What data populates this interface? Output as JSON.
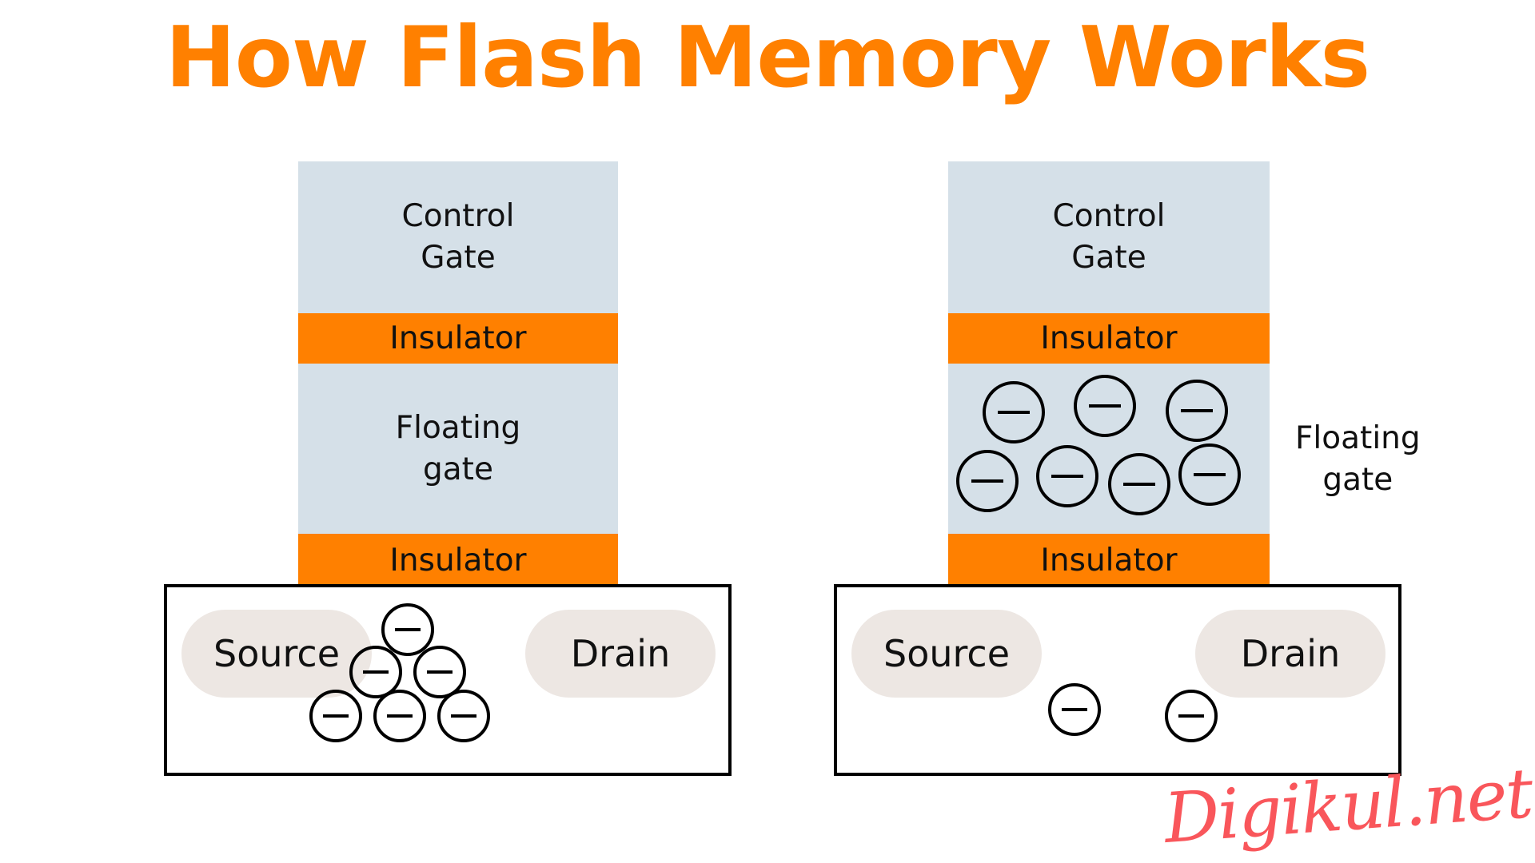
{
  "title": "How Flash Memory Works",
  "colors": {
    "title_orange": "#FF8000",
    "insulator_orange": "#FF8000",
    "gate_blue_gray": "#D5E0E8",
    "terminal_beige": "#EDE7E3",
    "outline_black": "#000000",
    "watermark_coral": "#F9565B",
    "background": "#FFFFFF"
  },
  "diagram": {
    "type": "flash-memory-cell-comparison",
    "cells": [
      {
        "id": "erased-cell",
        "position": "left",
        "layers": [
          {
            "name": "control-gate",
            "lines": [
              "Control",
              "Gate"
            ]
          },
          {
            "name": "insulator-top",
            "lines": [
              "Insulator"
            ]
          },
          {
            "name": "floating-gate",
            "lines": [
              "Floating",
              "gate"
            ]
          },
          {
            "name": "insulator-bottom",
            "lines": [
              "Insulator"
            ]
          }
        ],
        "floating_gate_electron_count": 0,
        "floating_gate_label_inside": true,
        "substrate": {
          "source_label": "Source",
          "drain_label": "Drain",
          "channel_electron_count": 6,
          "channel_electron_rows": [
            1,
            2,
            3
          ]
        }
      },
      {
        "id": "programmed-cell",
        "position": "right",
        "layers": [
          {
            "name": "control-gate",
            "lines": [
              "Control",
              "Gate"
            ]
          },
          {
            "name": "insulator-top",
            "lines": [
              "Insulator"
            ]
          },
          {
            "name": "floating-gate",
            "lines": []
          },
          {
            "name": "insulator-bottom",
            "lines": [
              "Insulator"
            ]
          }
        ],
        "floating_gate_electron_count": 7,
        "floating_gate_electron_rows": [
          3,
          4
        ],
        "floating_gate_label_inside": false,
        "floating_gate_side_label": {
          "lines": [
            "Floating",
            "gate"
          ]
        },
        "substrate": {
          "source_label": "Source",
          "drain_label": "Drain",
          "channel_electron_count": 2,
          "channel_electron_rows": [
            2
          ]
        }
      }
    ],
    "electron_symbol": "minus-sign-in-circle"
  },
  "watermark": "Digikul.net"
}
